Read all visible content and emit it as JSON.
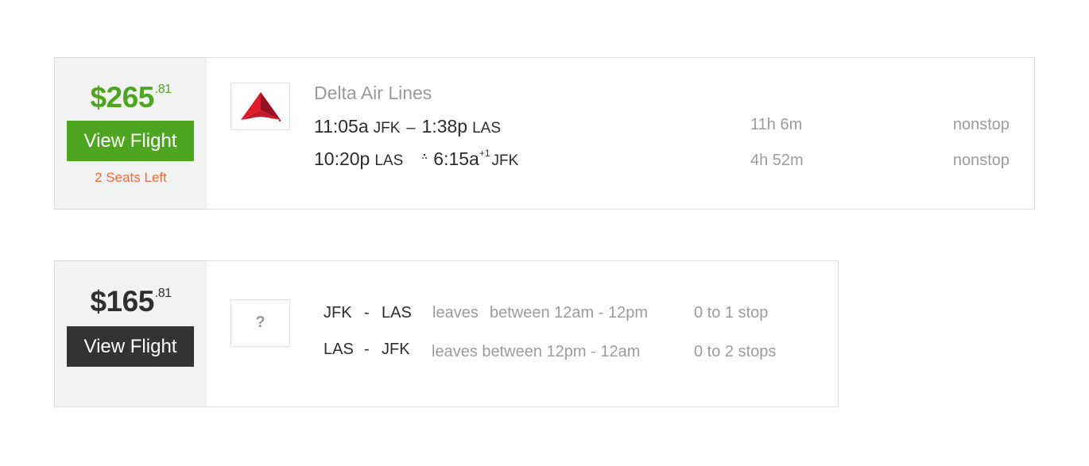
{
  "results": [
    {
      "price_main": "$265",
      "price_cents": ".81",
      "view_label": "View Flight",
      "seats_left": "2 Seats Left",
      "airline": "Delta Air Lines",
      "logo_icon": "delta-logo-icon",
      "legs": [
        {
          "depart_time": "11:05a",
          "depart_airport": "JFK",
          "separator": "–",
          "arrive_time": "1:38p",
          "arrive_airport": "LAS",
          "duration": "11h 6m",
          "stops": "nonstop"
        },
        {
          "depart_time": "10:20p",
          "depart_airport": "LAS",
          "overnight_icon": "moon-icon",
          "arrive_time": "6:15a",
          "day_offset": "+1",
          "arrive_airport": "JFK",
          "duration": "4h 52m",
          "stops": "nonstop"
        }
      ]
    },
    {
      "price_main": "$165",
      "price_cents": ".81",
      "view_label": "View Flight",
      "logo_placeholder": "?",
      "routes": [
        {
          "from": "JFK",
          "dash": "-",
          "to": "LAS",
          "leaves": "leaves",
          "window": "between 12am - 12pm",
          "stops": "0 to 1 stop"
        },
        {
          "from": "LAS",
          "dash": "-",
          "to": "JFK",
          "leaves": "leaves between 12pm - 12am",
          "stops": "0 to 2 stops"
        }
      ]
    }
  ],
  "colors": {
    "price_green": "#4ea51f",
    "button_dark": "#333333",
    "seats_orange": "#f06a3a",
    "panel_bg": "#f1f2f2",
    "muted_text": "#9c9c9c"
  }
}
